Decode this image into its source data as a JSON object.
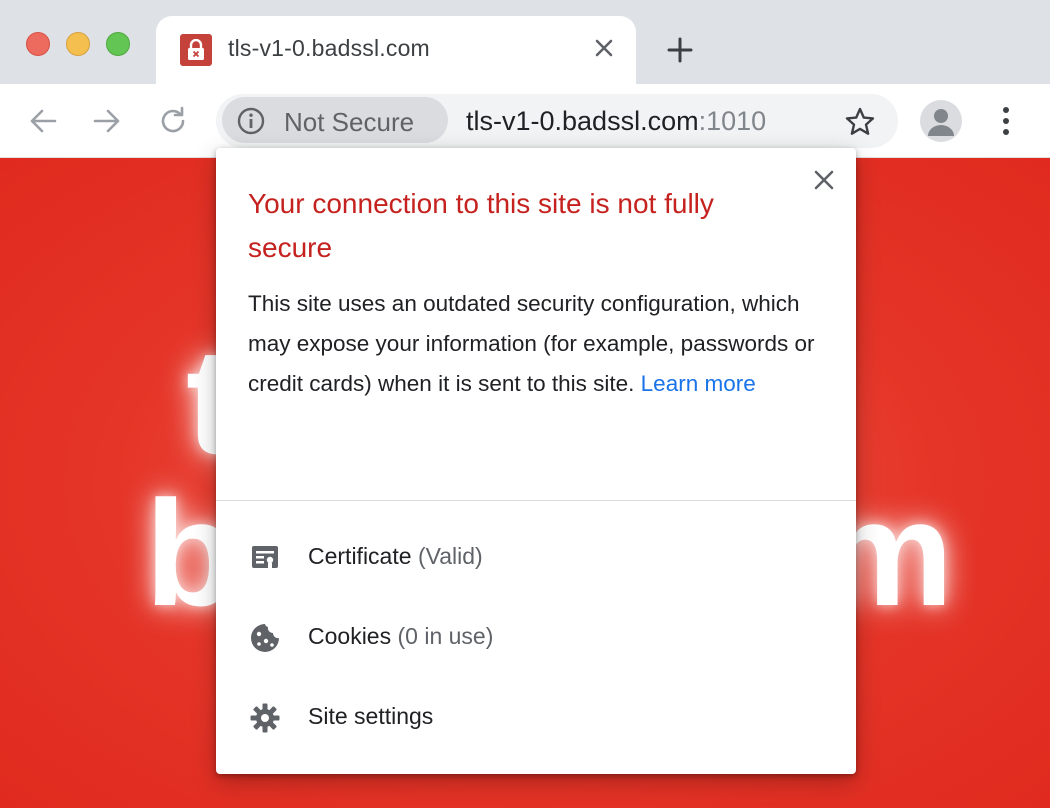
{
  "window": {
    "traffic_lights": [
      "close",
      "minimize",
      "zoom"
    ]
  },
  "tab": {
    "title": "tls-v1-0.badssl.com",
    "favicon": "lock-icon"
  },
  "toolbar": {
    "security_chip_label": "Not Secure",
    "url_host": "tls-v1-0.badssl.com",
    "url_port": ":1010"
  },
  "page": {
    "bg_line1": "t",
    "bg_line2_left": "b",
    "bg_line2_right": "m"
  },
  "popup": {
    "title": "Your connection to this site is not fully secure",
    "body": "This site uses an outdated security configuration, which may expose your information (for example, passwords or credit cards) when it is sent to this site.",
    "learn_more": "Learn more",
    "items": [
      {
        "label": "Certificate",
        "sub": "(Valid)",
        "icon": "certificate-icon"
      },
      {
        "label": "Cookies",
        "sub": "(0 in use)",
        "icon": "cookie-icon"
      },
      {
        "label": "Site settings",
        "sub": "",
        "icon": "gear-icon"
      }
    ]
  },
  "colors": {
    "page_background": "#e53528",
    "warning_title": "#c5221f",
    "link": "#1a73e8"
  }
}
